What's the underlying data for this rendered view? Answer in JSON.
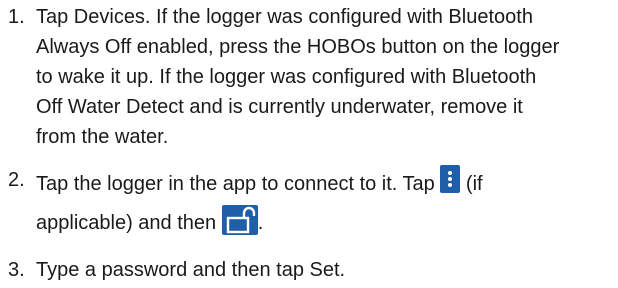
{
  "steps": [
    {
      "number": "1.",
      "lines": [
        "Tap Devices. If the logger was configured with Bluetooth",
        "Always Off enabled, press the HOBOs button on the logger",
        "to wake it up. If the logger was configured with Bluetooth",
        "Off Water Detect and is currently underwater, remove it",
        "from the water."
      ]
    },
    {
      "number": "2.",
      "line1_before_icon": "Tap the logger in the app to connect to it. Tap ",
      "line1_after_icon": " (if",
      "line2_before_icon": "applicable) and then ",
      "line2_after_icon": "."
    },
    {
      "number": "3.",
      "lines": [
        "Type a password and then tap Set."
      ]
    }
  ],
  "icons": {
    "menu": "more-vertical-icon",
    "unlock": "unlock-icon",
    "icon_color": "#1f5fa8"
  }
}
